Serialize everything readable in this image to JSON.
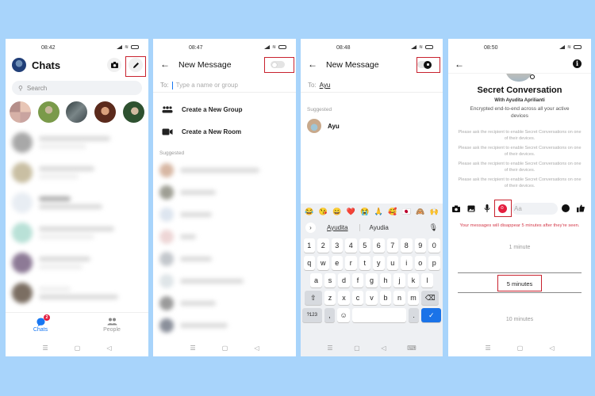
{
  "colors": {
    "background": "#a8d4fb",
    "accent": "#1877f2",
    "highlight_box": "#c8222e",
    "danger": "#e41e3f",
    "warning_text": "#d43a4a"
  },
  "screens": [
    {
      "status_time": "08:42",
      "title": "Chats",
      "header_icons": [
        "camera-icon",
        "edit-pencil-icon"
      ],
      "search_placeholder": "Search",
      "bottom_tabs": [
        {
          "label": "Chats",
          "icon": "chat-bubble-icon",
          "badge": "2",
          "active": true
        },
        {
          "label": "People",
          "icon": "people-icon",
          "active": false
        }
      ]
    },
    {
      "status_time": "08:47",
      "title": "New Message",
      "secret_toggle": "off",
      "to_label": "To:",
      "to_placeholder": "Type a name or group",
      "actions": [
        {
          "label": "Create a New Group",
          "icon": "group-icon"
        },
        {
          "label": "Create a New Room",
          "icon": "video-room-icon"
        }
      ],
      "suggested_label": "Suggested"
    },
    {
      "status_time": "08:48",
      "title": "New Message",
      "secret_toggle": "on",
      "to_label": "To:",
      "to_value": "Ayu",
      "suggested_label": "Suggested",
      "suggested": [
        {
          "name": "Ayu"
        }
      ],
      "keyboard": {
        "emoji_row": [
          "😂",
          "😘",
          "😀",
          "❤️",
          "😭",
          "🙏",
          "🥰",
          "🇯🇵",
          "🙈",
          "🙌"
        ],
        "suggestions": [
          "Ayudita",
          "Ayudia"
        ],
        "rows": [
          [
            "1",
            "2",
            "3",
            "4",
            "5",
            "6",
            "7",
            "8",
            "9",
            "0"
          ],
          [
            "q",
            "w",
            "e",
            "r",
            "t",
            "y",
            "u",
            "i",
            "o",
            "p"
          ],
          [
            "a",
            "s",
            "d",
            "f",
            "g",
            "h",
            "j",
            "k",
            "l"
          ],
          [
            "z",
            "x",
            "c",
            "v",
            "b",
            "n",
            "m"
          ]
        ],
        "symbols_key": "?123",
        "comma_key": ",",
        "period_key": "."
      }
    },
    {
      "status_time": "08:50",
      "title": "Secret Conversation",
      "with_line": "With Ayudita Aprilianti",
      "encryption_note": "Encrypted end-to-end across all your active devices",
      "recipient_notes": [
        "Please ask the recipient to enable Secret Conversations on one of their devices.",
        "Please ask the recipient to enable Secret Conversations on one of their devices.",
        "Please ask the recipient to enable Secret Conversations on one of their devices.",
        "Please ask the recipient to enable Secret Conversations on one of their devices."
      ],
      "composer_placeholder": "Aa",
      "disappear_notice": "Your messages will disappear 5 minutes after they're seen.",
      "timer_options": [
        "1 minute",
        "5 minutes",
        "10 minutes"
      ],
      "timer_selected": "5 minutes"
    }
  ]
}
